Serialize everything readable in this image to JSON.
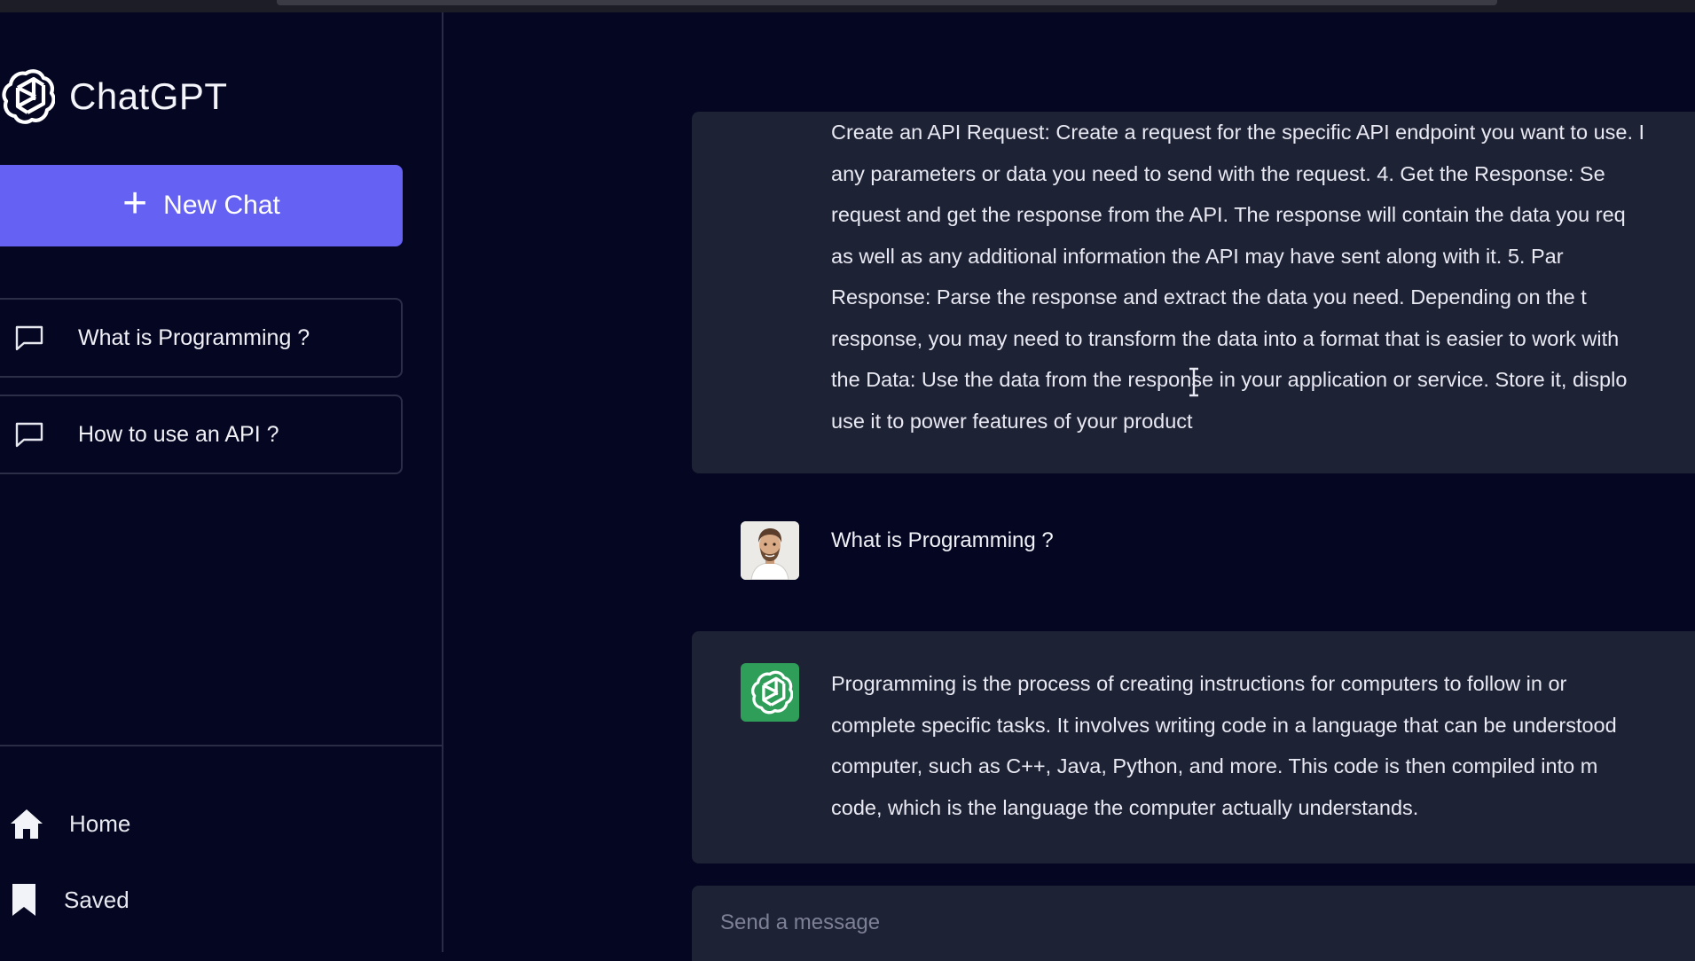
{
  "app": {
    "name": "ChatGPT"
  },
  "sidebar": {
    "new_chat_label": "New Chat",
    "history": [
      {
        "label": "What is Programming ?"
      },
      {
        "label": "How to use an API ?"
      }
    ],
    "nav": [
      {
        "label": "Home",
        "icon": "home-icon"
      },
      {
        "label": "Saved",
        "icon": "bookmark-icon"
      }
    ]
  },
  "conversation": {
    "previous_answer_lines": [
      "Create an API Request: Create a request for the specific API endpoint you want to use. I",
      "any parameters or data you need to send with the request. 4. Get the Response: Se",
      "request and get the response from the API. The response will contain the data you req",
      "as well as any additional information the API may have sent along with it. 5. Par",
      "Response: Parse the response and extract the data you need. Depending on the t",
      "response, you may need to transform the data into a format that is easier to work with",
      "the Data: Use the data from the response in your application or service. Store it, displo",
      "use it to power features of your product"
    ],
    "user_question": "What is Programming ?",
    "answer_lines": [
      "Programming is the process of creating instructions for computers to follow in or",
      "complete specific tasks. It involves writing code in a language that can be understood",
      "computer, such as C++, Java, Python, and more. This code is then compiled into m",
      "code, which is the language the computer actually understands."
    ]
  },
  "composer": {
    "placeholder": "Send a message",
    "value": ""
  },
  "colors": {
    "background": "#050722",
    "panel": "#1e2235",
    "accent": "#6461f3",
    "gpt_green": "#2e9e59",
    "border": "#2c2e48"
  }
}
